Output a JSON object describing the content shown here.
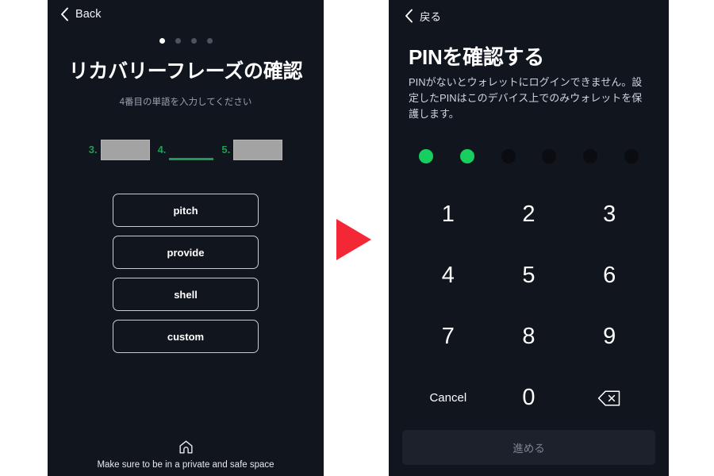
{
  "colors": {
    "panel_bg": "#11151e",
    "accent_green": "#17cf5e",
    "slot_green": "#1f9a55",
    "arrow_red": "#f32735",
    "redaction_gray": "#a3a3a3",
    "disabled_button_bg": "#1c212c",
    "disabled_button_text": "#7d838f"
  },
  "left_screen": {
    "back": {
      "label": "Back",
      "icon": "chevron-left-icon"
    },
    "pagination": {
      "total": 4,
      "active_index": 0
    },
    "title": "リカバリーフレーズの確認",
    "subtitle": "4番目の単語を入力してください",
    "slots": [
      {
        "number": "3.",
        "state": "filled-redacted"
      },
      {
        "number": "4.",
        "state": "empty-active"
      },
      {
        "number": "5.",
        "state": "filled-redacted"
      }
    ],
    "options": [
      "pitch",
      "provide",
      "shell",
      "custom"
    ],
    "footer": {
      "icon": "home-icon",
      "text": "Make sure to be in a private and safe space"
    }
  },
  "transition_arrow": {
    "icon": "play-triangle-right-icon"
  },
  "right_screen": {
    "back": {
      "label": "戻る",
      "icon": "chevron-left-icon"
    },
    "title": "PINを確認する",
    "description": "PINがないとウォレットにログインできません。設定したPINはこのデバイス上でのみウォレットを保護します。",
    "pin_dots": {
      "total": 6,
      "filled": 2
    },
    "keypad": [
      {
        "label": "1",
        "name": "key-1"
      },
      {
        "label": "2",
        "name": "key-2"
      },
      {
        "label": "3",
        "name": "key-3"
      },
      {
        "label": "4",
        "name": "key-4"
      },
      {
        "label": "5",
        "name": "key-5"
      },
      {
        "label": "6",
        "name": "key-6"
      },
      {
        "label": "7",
        "name": "key-7"
      },
      {
        "label": "8",
        "name": "key-8"
      },
      {
        "label": "9",
        "name": "key-9"
      },
      {
        "label": "Cancel",
        "name": "key-cancel"
      },
      {
        "label": "0",
        "name": "key-0"
      },
      {
        "label": "",
        "name": "key-backspace",
        "icon": "backspace-icon"
      }
    ],
    "submit_button": {
      "label": "進める",
      "enabled": false
    }
  }
}
